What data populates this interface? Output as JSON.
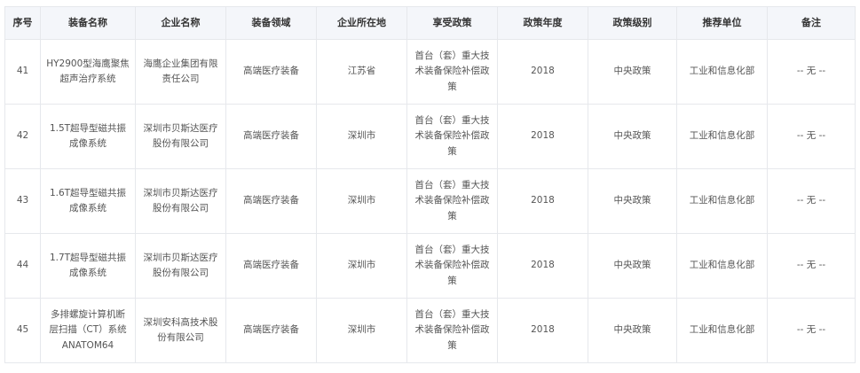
{
  "table": {
    "headers": [
      "序号",
      "装备名称",
      "企业名称",
      "装备领域",
      "企业所在地",
      "享受政策",
      "政策年度",
      "政策级别",
      "推荐单位",
      "备注"
    ],
    "rows": [
      [
        "41",
        "HY2900型海鹰聚焦超声治疗系统",
        "海鹰企业集团有限责任公司",
        "高端医疗装备",
        "江苏省",
        "首台（套）重大技术装备保险补偿政策",
        "2018",
        "中央政策",
        "工业和信息化部",
        "-- 无 --"
      ],
      [
        "42",
        "1.5T超导型磁共振成像系统",
        "深圳市贝斯达医疗股份有限公司",
        "高端医疗装备",
        "深圳市",
        "首台（套）重大技术装备保险补偿政策",
        "2018",
        "中央政策",
        "工业和信息化部",
        "-- 无 --"
      ],
      [
        "43",
        "1.6T超导型磁共振成像系统",
        "深圳市贝斯达医疗股份有限公司",
        "高端医疗装备",
        "深圳市",
        "首台（套）重大技术装备保险补偿政策",
        "2018",
        "中央政策",
        "工业和信息化部",
        "-- 无 --"
      ],
      [
        "44",
        "1.7T超导型磁共振成像系统",
        "深圳市贝斯达医疗股份有限公司",
        "高端医疗装备",
        "深圳市",
        "首台（套）重大技术装备保险补偿政策",
        "2018",
        "中央政策",
        "工业和信息化部",
        "-- 无 --"
      ],
      [
        "45",
        "多排螺旋计算机断层扫描（CT）系统ANATOM64",
        "深圳安科高技术股份有限公司",
        "高端医疗装备",
        "深圳市",
        "首台（套）重大技术装备保险补偿政策",
        "2018",
        "中央政策",
        "工业和信息化部",
        "-- 无 --"
      ]
    ]
  }
}
